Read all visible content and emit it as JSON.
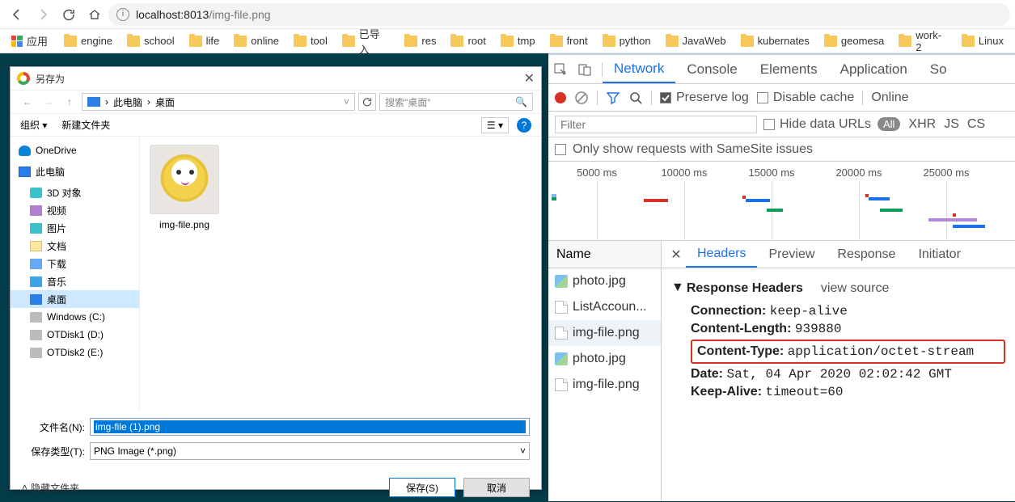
{
  "url": {
    "host": "localhost:",
    "port": "8013",
    "path": "/img-file.png"
  },
  "bookmarks": {
    "apps_label": "应用",
    "items": [
      "engine",
      "school",
      "life",
      "online",
      "tool",
      "已导入",
      "res",
      "root",
      "tmp",
      "front",
      "python",
      "JavaWeb",
      "kubernates",
      "geomesa",
      "work-2",
      "Linux"
    ]
  },
  "devtools": {
    "tabs": [
      "Network",
      "Console",
      "Elements",
      "Application",
      "So"
    ],
    "active_tab": 0,
    "toolbar": {
      "preserve": "Preserve log",
      "disable": "Disable cache",
      "online": "Online"
    },
    "filter": {
      "placeholder": "Filter",
      "hide_urls": "Hide data URLs",
      "pills": [
        "All",
        "XHR",
        "JS",
        "CS"
      ]
    },
    "samesite": "Only show requests with SameSite issues",
    "timeline": {
      "ticks": [
        "5000 ms",
        "10000 ms",
        "15000 ms",
        "20000 ms",
        "25000 ms"
      ]
    },
    "requests": {
      "header": "Name",
      "items": [
        {
          "name": "photo.jpg",
          "type": "img"
        },
        {
          "name": "ListAccoun...",
          "type": "file"
        },
        {
          "name": "img-file.png",
          "type": "file",
          "selected": true
        },
        {
          "name": "photo.jpg",
          "type": "img"
        },
        {
          "name": "img-file.png",
          "type": "file"
        }
      ]
    },
    "detail_tabs": [
      "Headers",
      "Preview",
      "Response",
      "Initiator"
    ],
    "detail_active": 0,
    "headers": {
      "section": "Response Headers",
      "view_source": "view source",
      "rows": [
        {
          "k": "Connection:",
          "v": "keep-alive"
        },
        {
          "k": "Content-Length:",
          "v": "939880"
        },
        {
          "k": "Content-Type:",
          "v": "application/octet-stream",
          "hl": true
        },
        {
          "k": "Date:",
          "v": "Sat, 04 Apr 2020 02:02:42 GMT"
        },
        {
          "k": "Keep-Alive:",
          "v": "timeout=60"
        }
      ]
    }
  },
  "dialog": {
    "title": "另存为",
    "path": [
      "此电脑",
      "桌面"
    ],
    "search_placeholder": "搜索\"桌面\"",
    "organize": "组织",
    "newfolder": "新建文件夹",
    "tree": [
      {
        "label": "OneDrive",
        "icon": "i-cloud",
        "root": true
      },
      {
        "label": "此电脑",
        "icon": "i-pc",
        "root": true
      },
      {
        "label": "3D 对象",
        "icon": "i-3d"
      },
      {
        "label": "视频",
        "icon": "i-vid"
      },
      {
        "label": "图片",
        "icon": "i-img"
      },
      {
        "label": "文档",
        "icon": "i-doc"
      },
      {
        "label": "下载",
        "icon": "i-dl"
      },
      {
        "label": "音乐",
        "icon": "i-mus"
      },
      {
        "label": "桌面",
        "icon": "i-desk",
        "selected": true
      },
      {
        "label": "Windows (C:)",
        "icon": "i-drv"
      },
      {
        "label": "OTDisk1 (D:)",
        "icon": "i-drv"
      },
      {
        "label": "OTDisk2 (E:)",
        "icon": "i-drv"
      }
    ],
    "thumb": "img-file.png",
    "filename_label": "文件名(N):",
    "filename_value": "img-file (1).png",
    "type_label": "保存类型(T):",
    "type_value": "PNG Image (*.png)",
    "hide_folders": "隐藏文件夹",
    "save": "保存(S)",
    "cancel": "取消"
  }
}
